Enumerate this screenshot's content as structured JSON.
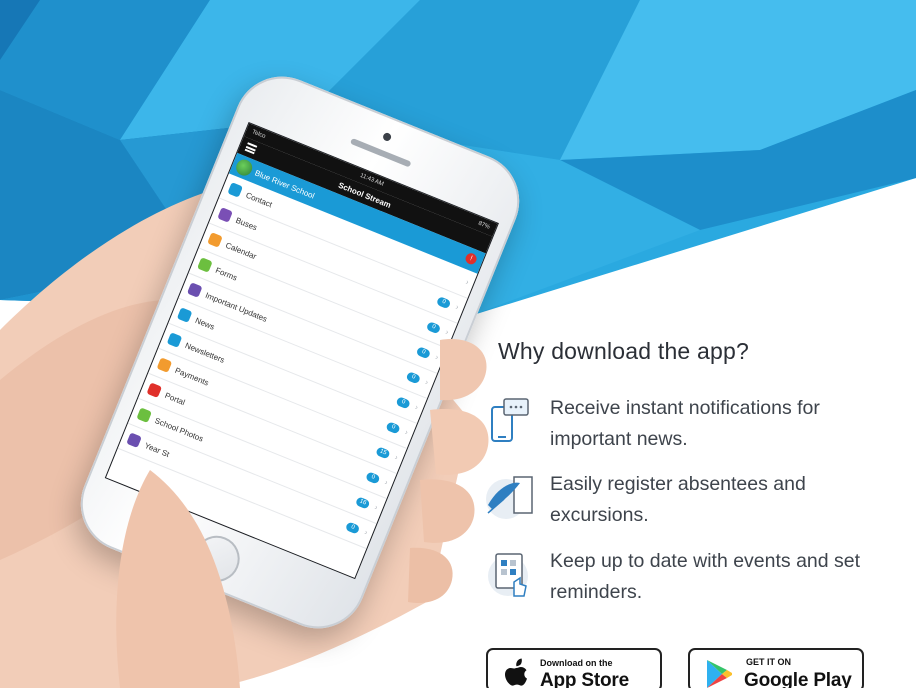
{
  "colors": {
    "accent": "#1a9ad6",
    "background_blue": "#27a7de",
    "heading_text": "#2b2f36",
    "body_text": "#3e444c",
    "alert": "#e0302a"
  },
  "phone": {
    "status_carrier": "Telco",
    "status_time": "11:43 AM",
    "status_battery": "87%",
    "app_title": "School Stream",
    "school_name": "Blue River School",
    "alert_count": "!",
    "menu_items": [
      {
        "label": "Contact",
        "icon": "contact-icon",
        "icon_color": "#1a9ad6",
        "badge": ""
      },
      {
        "label": "Buses",
        "icon": "bus-icon",
        "icon_color": "#7a4fb5",
        "badge": "0"
      },
      {
        "label": "Calendar",
        "icon": "calendar-icon",
        "icon_color": "#f29b2e",
        "badge": "0"
      },
      {
        "label": "Forms",
        "icon": "forms-icon",
        "icon_color": "#6cbf3f",
        "badge": "0"
      },
      {
        "label": "Important Updates",
        "icon": "updates-icon",
        "icon_color": "#6b4fb0",
        "badge": "0"
      },
      {
        "label": "News",
        "icon": "news-icon",
        "icon_color": "#1a9ad6",
        "badge": "0"
      },
      {
        "label": "Newsletters",
        "icon": "newsletter-icon",
        "icon_color": "#1a9ad6",
        "badge": "0"
      },
      {
        "label": "Payments",
        "icon": "payments-icon",
        "icon_color": "#f29b2e",
        "badge": "15"
      },
      {
        "label": "Portal",
        "icon": "portal-icon",
        "icon_color": "#e0302a",
        "badge": "0"
      },
      {
        "label": "School Photos",
        "icon": "photos-icon",
        "icon_color": "#6cbf3f",
        "badge": "16"
      },
      {
        "label": "Year St",
        "icon": "year-icon",
        "icon_color": "#6b4fb0",
        "badge": "0"
      }
    ]
  },
  "content": {
    "heading": "Why download the app?",
    "features": [
      {
        "text": "Receive instant notifications for important news.",
        "icon": "phone-chat-icon"
      },
      {
        "text": "Easily register absentees and excursions.",
        "icon": "quill-scroll-icon"
      },
      {
        "text": "Keep up to date with events and set reminders.",
        "icon": "calendar-touch-icon"
      }
    ]
  },
  "badges": {
    "app_store": {
      "small": "Download on the",
      "big": "App Store",
      "icon": "apple-icon"
    },
    "google_play": {
      "small": "GET IT ON",
      "big": "Google Play",
      "icon": "google-play-icon"
    }
  }
}
